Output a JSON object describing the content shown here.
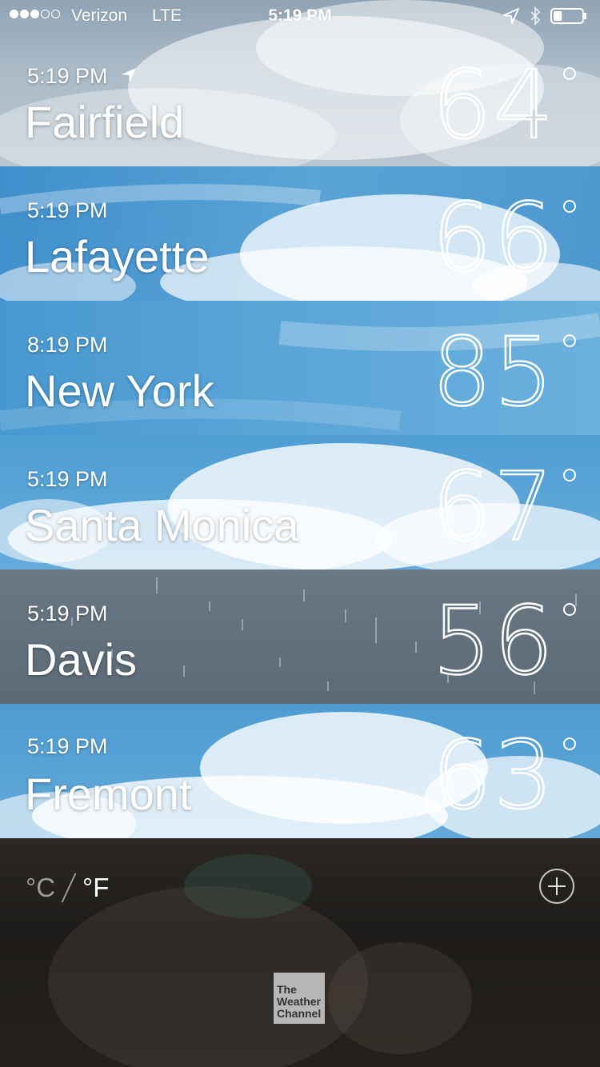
{
  "status_bar": {
    "signal_dots_filled": 3,
    "signal_dots_total": 5,
    "carrier": "Verizon",
    "network": "LTE",
    "time": "5:19 PM",
    "battery_level": 0.3
  },
  "cities": [
    {
      "time": "5:19 PM",
      "name": "Fairfield",
      "temp": "64",
      "current_location": true,
      "condition": "cloudy"
    },
    {
      "time": "5:19 PM",
      "name": "Lafayette",
      "temp": "66",
      "current_location": false,
      "condition": "partly-cloudy"
    },
    {
      "time": "8:19 PM",
      "name": "New York",
      "temp": "85",
      "current_location": false,
      "condition": "clear"
    },
    {
      "time": "5:19 PM",
      "name": "Santa Monica",
      "temp": "67",
      "current_location": false,
      "condition": "cloudy"
    },
    {
      "time": "5:19 PM",
      "name": "Davis",
      "temp": "56",
      "current_location": false,
      "condition": "rain"
    },
    {
      "time": "5:19 PM",
      "name": "Fremont",
      "temp": "63",
      "current_location": false,
      "condition": "cloudy"
    }
  ],
  "footer": {
    "unit_celsius": "C",
    "unit_fahrenheit": "F",
    "selected_unit": "F",
    "logo_line1": "The",
    "logo_line2": "Weather",
    "logo_line3": "Channel"
  },
  "colors": {
    "sky_blue": "#4a9ad0",
    "sky_grey": "#9fb3c3",
    "rain_grey": "#5e6c79",
    "footer_dark": "#211f1c"
  }
}
